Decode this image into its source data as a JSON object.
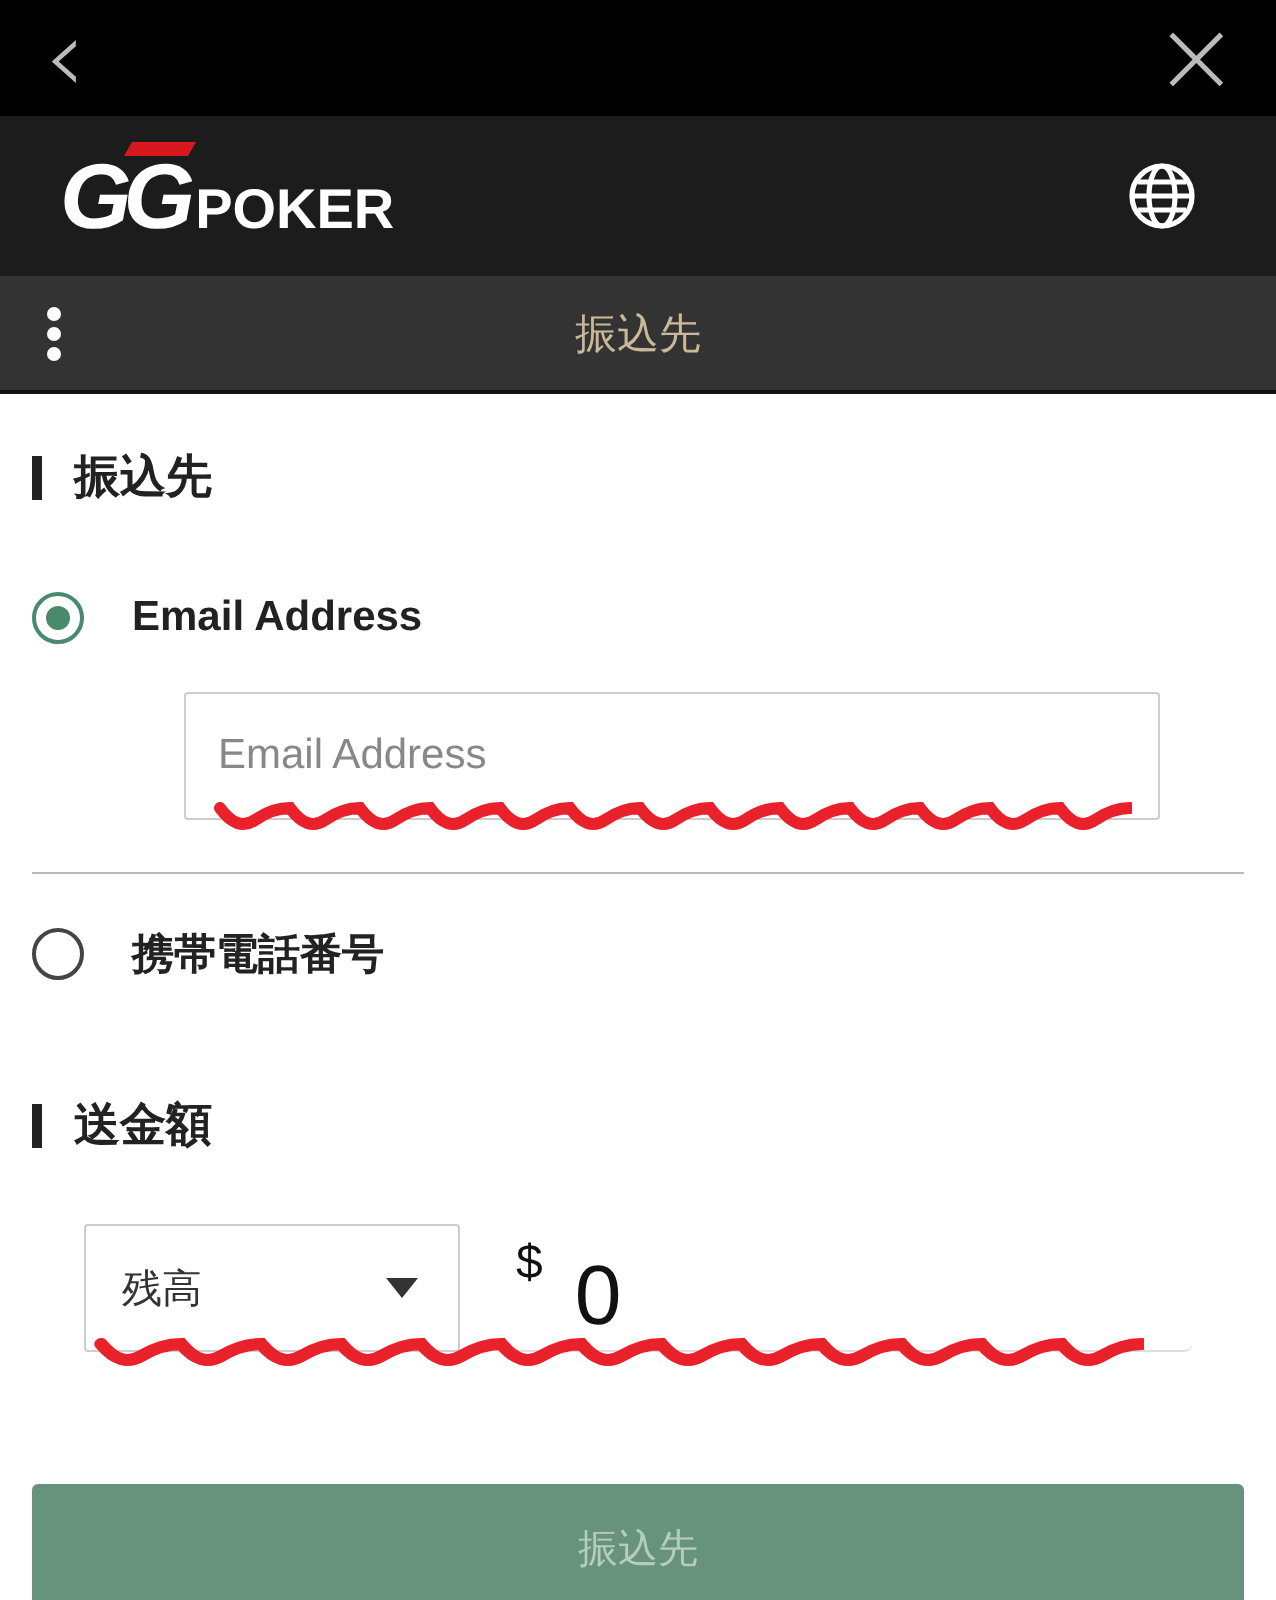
{
  "top_bar": {
    "back": "‹",
    "close": "×"
  },
  "header": {
    "logo_mark": "GG",
    "logo_word": "POKER"
  },
  "sub_bar": {
    "title": "振込先"
  },
  "recipient": {
    "heading": "振込先",
    "options": [
      {
        "label": "Email Address",
        "selected": true,
        "placeholder": "Email Address"
      },
      {
        "label": "携帯電話番号",
        "selected": false
      }
    ]
  },
  "amount": {
    "heading": "送金額",
    "select_value": "残高",
    "currency": "$",
    "value": "0"
  },
  "submit": {
    "label": "振込先",
    "disabled": true
  }
}
